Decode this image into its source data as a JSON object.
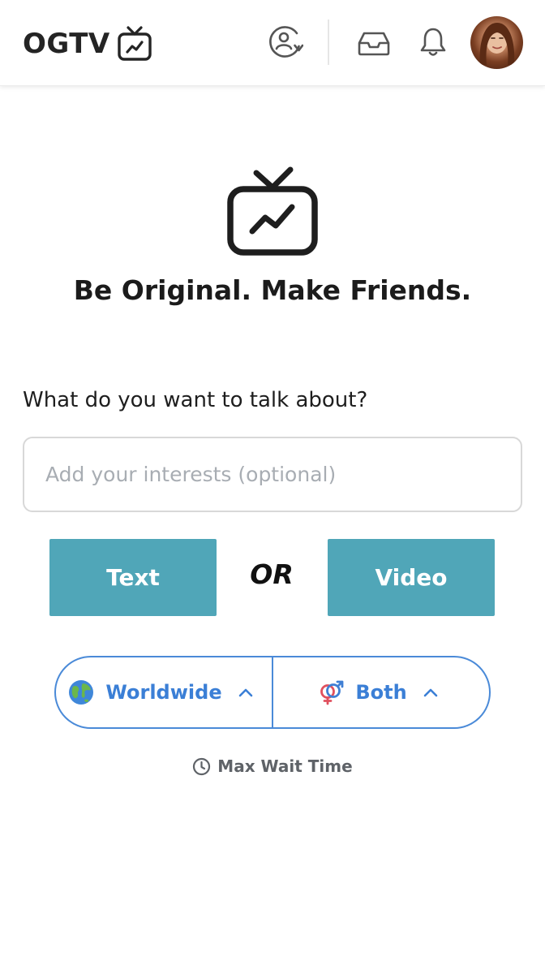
{
  "header": {
    "logo_text": "OGTV",
    "icons": {
      "swap": "user-switch-icon",
      "inbox": "inbox-icon",
      "notifications": "bell-icon",
      "avatar": "profile-avatar"
    }
  },
  "main": {
    "tagline": "Be Original. Make Friends.",
    "question": "What do you want to talk about?",
    "interests": {
      "placeholder": "Add your interests (optional)",
      "value": ""
    },
    "text_button": "Text",
    "or_label": "OR",
    "video_button": "Video"
  },
  "filters": {
    "region": {
      "label": "Worldwide",
      "icon": "globe-icon"
    },
    "gender": {
      "label": "Both",
      "icon": "gender-symbols-icon"
    }
  },
  "wait": {
    "label": "Max Wait Time",
    "icon": "clock-icon"
  },
  "colors": {
    "accent": "#50a6b8",
    "filter_blue": "#3b7fd6",
    "text_dark": "#1c1c1c",
    "muted": "#5f6368"
  }
}
